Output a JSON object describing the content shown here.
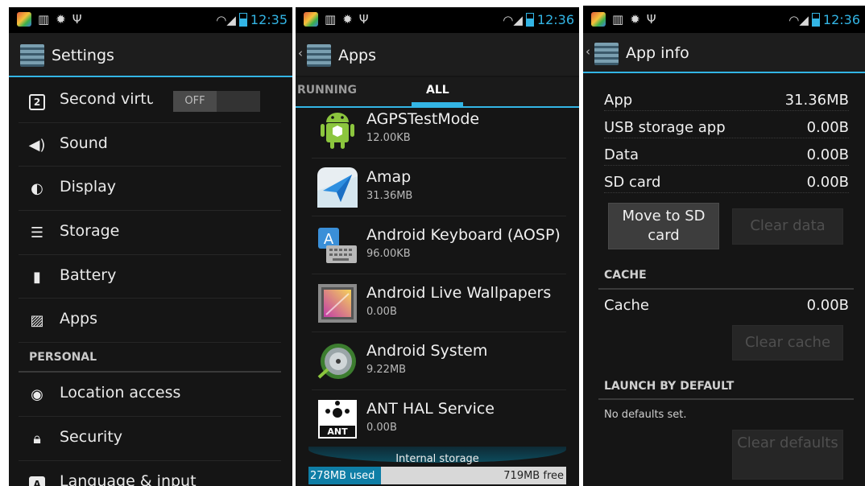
{
  "status": {
    "times": [
      "12:35",
      "12:36",
      "12:36"
    ]
  },
  "settings": {
    "title": "Settings",
    "items": [
      {
        "label": "Second virtua",
        "icon": "dual-screen-icon",
        "toggle": "OFF"
      },
      {
        "label": "Sound",
        "icon": "speaker-icon"
      },
      {
        "label": "Display",
        "icon": "brightness-icon"
      },
      {
        "label": "Storage",
        "icon": "storage-icon"
      },
      {
        "label": "Battery",
        "icon": "battery-icon"
      },
      {
        "label": "Apps",
        "icon": "apps-icon"
      }
    ],
    "section": "PERSONAL",
    "personal_items": [
      {
        "label": "Location access",
        "icon": "location-icon"
      },
      {
        "label": "Security",
        "icon": "lock-icon"
      },
      {
        "label": "Language & input",
        "icon": "language-icon"
      }
    ]
  },
  "apps": {
    "title": "Apps",
    "tabs": [
      "RUNNING",
      "ALL"
    ],
    "list": [
      {
        "name": "AGPSTestMode",
        "size": "12.00KB",
        "icon": "android-icon"
      },
      {
        "name": "Amap",
        "size": "31.36MB",
        "icon": "amap-icon"
      },
      {
        "name": "Android Keyboard (AOSP)",
        "size": "96.00KB",
        "icon": "keyboard-icon"
      },
      {
        "name": "Android Live Wallpapers",
        "size": "0.00B",
        "icon": "wallpaper-icon"
      },
      {
        "name": "Android System",
        "size": "9.22MB",
        "icon": "android-system-icon"
      },
      {
        "name": "ANT HAL Service",
        "size": "0.00B",
        "icon": "ant-icon"
      }
    ],
    "storage": {
      "title": "Internal storage",
      "used": "278MB used",
      "free": "719MB free",
      "used_fraction": 0.28
    }
  },
  "appinfo": {
    "title": "App info",
    "rows": [
      {
        "k": "App",
        "v": "31.36MB"
      },
      {
        "k": "USB storage app",
        "v": "0.00B"
      },
      {
        "k": "Data",
        "v": "0.00B"
      },
      {
        "k": "SD card",
        "v": "0.00B"
      }
    ],
    "move_btn": "Move to SD card",
    "clear_data_btn": "Clear data",
    "cache_header": "CACHE",
    "cache_row": {
      "k": "Cache",
      "v": "0.00B"
    },
    "clear_cache_btn": "Clear cache",
    "launch_header": "LAUNCH BY DEFAULT",
    "no_defaults": "No defaults set.",
    "clear_defaults_btn": "Clear defaults"
  },
  "colors": {
    "accent": "#33b5e5",
    "background": "#151515"
  }
}
